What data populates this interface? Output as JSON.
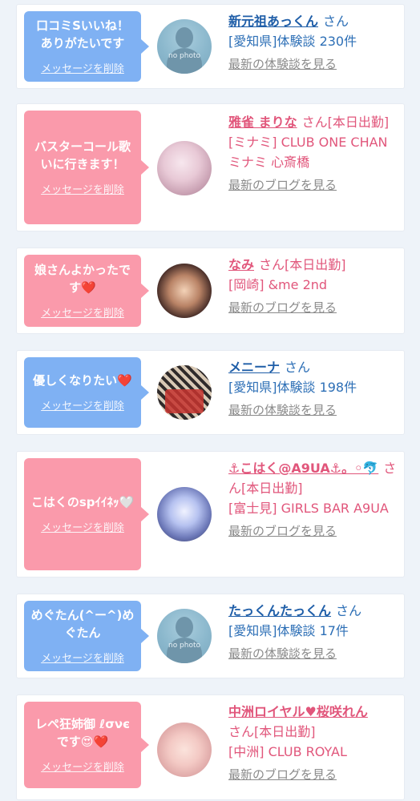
{
  "cards": [
    {
      "type": "review",
      "message": "口コミSいいね！ありがたいです",
      "delete_label": "メッセージを削除",
      "avatar": "no-photo",
      "avatar_text": "no photo",
      "name": "新元祖あっくん",
      "honorific": "さん",
      "detail": "[愛知県]体験談 230件",
      "link_label": "最新の体験談を見る"
    },
    {
      "type": "cast",
      "message": "バスターコール歌いに行きます！",
      "delete_label": "メッセージを削除",
      "avatar": "photo",
      "name": "雅雀 まりな",
      "honorific": "さん[本日出勤]",
      "detail": "[ミナミ] CLUB ONE CHAN ミナミ 心斎橋",
      "link_label": "最新のブログを見る"
    },
    {
      "type": "cast",
      "message": "娘さんよかったです❤️",
      "delete_label": "メッセージを削除",
      "avatar": "photo",
      "name": "なみ",
      "honorific": "さん[本日出勤]",
      "detail": "[岡崎] &me 2nd",
      "link_label": "最新のブログを見る"
    },
    {
      "type": "review",
      "message": "優しくなりたい❤️",
      "delete_label": "メッセージを削除",
      "avatar": "photo",
      "name": "メニーナ",
      "honorific": "さん",
      "detail": "[愛知県]体験談 198件",
      "link_label": "最新の体験談を見る"
    },
    {
      "type": "cast",
      "message": "こはくのspｲｲﾈｯ🤍",
      "delete_label": "メッセージを削除",
      "avatar": "photo",
      "name": "⚓こはく@A9UA⚓。◦🐬",
      "honorific": "さん[本日出勤]",
      "detail": "[富士見] GIRLS BAR A9UA",
      "link_label": "最新のブログを見る"
    },
    {
      "type": "review",
      "message": "めぐたん(^ー^)めぐたん",
      "delete_label": "メッセージを削除",
      "avatar": "no-photo",
      "avatar_text": "no photo",
      "name": "たっくんたっくん",
      "honorific": "さん",
      "detail": "[愛知県]体験談 17件",
      "link_label": "最新の体験談を見る"
    },
    {
      "type": "cast",
      "message": "レペ狂姉御 ℓσνє です😍❤️",
      "delete_label": "メッセージを削除",
      "avatar": "photo",
      "name": "中洲ロイヤル♥桜咲れん",
      "honorific": "さん[本日出勤]",
      "detail": "[中洲] CLUB ROYAL",
      "link_label": "最新のブログを見る"
    }
  ],
  "colors": {
    "review_bubble": "#7fb1f3",
    "cast_bubble": "#fa9aab",
    "review_text": "#1f5ea8",
    "cast_text": "#e1567b"
  }
}
